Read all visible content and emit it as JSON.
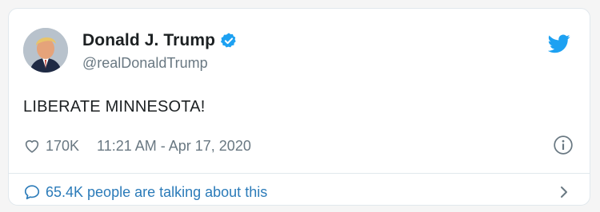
{
  "tweet": {
    "author": {
      "display_name": "Donald J. Trump",
      "handle": "@realDonaldTrump",
      "verified": true
    },
    "text": "LIBERATE MINNESOTA!",
    "likes": "170K",
    "timestamp": "11:21 AM - Apr 17, 2020",
    "conversation": "65.4K people are talking about this"
  },
  "icons": {
    "brand": "twitter-bird-icon",
    "verified": "verified-badge-icon",
    "like": "heart-icon",
    "info": "info-icon",
    "reply": "speech-bubble-icon",
    "open": "chevron-right-icon"
  },
  "colors": {
    "brand": "#1da1f2",
    "link": "#2b7bb9",
    "muted": "#697882",
    "text": "#1c2022",
    "border": "#e1e8ed"
  }
}
